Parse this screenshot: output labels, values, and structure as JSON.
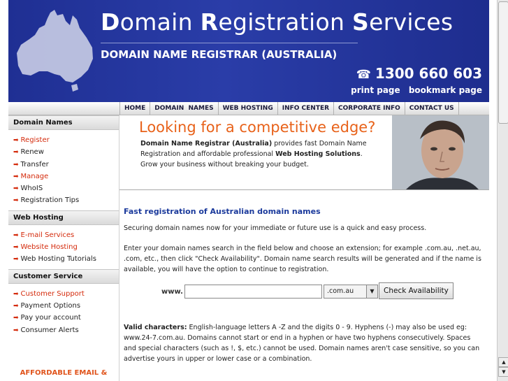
{
  "header": {
    "title_parts": [
      {
        "cap": "D",
        "rest": "omain "
      },
      {
        "cap": "R",
        "rest": "egistration "
      },
      {
        "cap": "S",
        "rest": "ervices"
      }
    ],
    "subtitle": "DOMAIN NAME REGISTRAR (AUSTRALIA)",
    "phone": "1300 660 603",
    "links": [
      "print page",
      "bookmark page"
    ]
  },
  "nav": [
    "HOME",
    "DOMAIN  NAMES",
    "WEB HOSTING",
    "INFO CENTER",
    "CORPORATE INFO",
    "CONTACT US"
  ],
  "sidebar": {
    "sections": [
      {
        "heading": "Domain Names",
        "items": [
          {
            "label": "Register",
            "red": true
          },
          {
            "label": "Renew",
            "red": false
          },
          {
            "label": "Transfer",
            "red": false
          },
          {
            "label": "Manage",
            "red": true
          },
          {
            "label": "WhoIS",
            "red": false
          },
          {
            "label": "Registration Tips",
            "red": false
          }
        ]
      },
      {
        "heading": "Web Hosting",
        "items": [
          {
            "label": "E-mail Services",
            "red": true
          },
          {
            "label": "Website Hosting",
            "red": true
          },
          {
            "label": "Web Hosting Tutorials",
            "red": false
          }
        ]
      },
      {
        "heading": "Customer Service",
        "items": [
          {
            "label": "Customer Support",
            "red": true
          },
          {
            "label": "Payment Options",
            "red": false
          },
          {
            "label": "Pay your account",
            "red": false
          },
          {
            "label": "Consumer Alerts",
            "red": false
          }
        ]
      }
    ],
    "promo": "AFFORDABLE EMAIL &"
  },
  "banner": {
    "headline": "Looking for a competitive edge?",
    "intro_bold1": "Domain Name Registrar (Australia)",
    "intro_text1": " provides fast Domain Name Registration and affordable professional ",
    "intro_bold2": "Web Hosting Solutions",
    "intro_text2": ". Grow your business without breaking your budget."
  },
  "main": {
    "heading": "Fast registration of Australian domain names",
    "para1": "Securing domain names now for your immediate or future use is a quick and easy process.",
    "para2": "Enter your domain names search in the field below and choose an extension; for example .com.au, .net.au, .com, etc., then click \"Check Availability\". Domain name search results will be generated and if the name is available, you will have the option to continue to registration.",
    "search": {
      "www_label": "www.",
      "input_value": "",
      "extension": ".com.au",
      "button": "Check Availability"
    },
    "valid_label": "Valid characters:",
    "valid_text": " English-language letters A -Z and the digits 0 - 9. Hyphens (-) may also be used eg: www.24-7.com.au. Domains cannot start or end in a hyphen or have two hyphens consecutively. Spaces and special characters (such as !, $, etc.) cannot be used. Domain names aren't case sensitive, so you can advertise yours in upper or lower case or a combination."
  },
  "colors": {
    "header_blue": "#2a3da8",
    "headline_orange": "#e8621a",
    "heading_blue": "#1b3a9c",
    "link_red": "#d42a0b"
  }
}
